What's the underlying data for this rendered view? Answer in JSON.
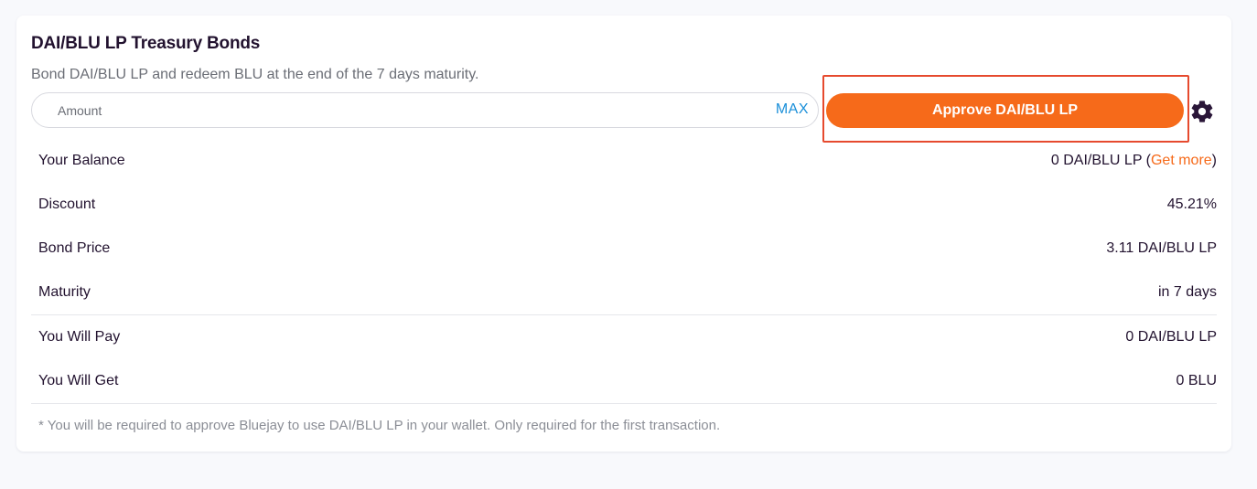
{
  "bond": {
    "title": "DAI/BLU LP Treasury Bonds",
    "subtitle": "Bond DAI/BLU LP and redeem BLU at the end of the 7 days maturity."
  },
  "amount": {
    "placeholder": "Amount",
    "value": "",
    "max_label": "MAX"
  },
  "approve": {
    "label": "Approve DAI/BLU LP"
  },
  "settings": {
    "icon": "gear-icon"
  },
  "details": {
    "balance": {
      "label": "Your Balance",
      "value": "0 DAI/BLU LP",
      "open_paren": " (",
      "link": "Get more",
      "close_paren": ")"
    },
    "discount": {
      "label": "Discount",
      "value": "45.21%"
    },
    "bond_price": {
      "label": "Bond Price",
      "value": "3.11 DAI/BLU LP"
    },
    "maturity": {
      "label": "Maturity",
      "value": "in 7 days"
    },
    "pay": {
      "label": "You Will Pay",
      "value": "0 DAI/BLU LP"
    },
    "get": {
      "label": "You Will Get",
      "value": "0 BLU"
    }
  },
  "footnote": "* You will be required to approve Bluejay to use DAI/BLU LP in your wallet. Only required for the first transaction.",
  "colors": {
    "accent": "#f66a1a",
    "link_blue": "#1a8fd9",
    "highlight_border": "#e64a2e",
    "text_dark": "#22122f"
  }
}
